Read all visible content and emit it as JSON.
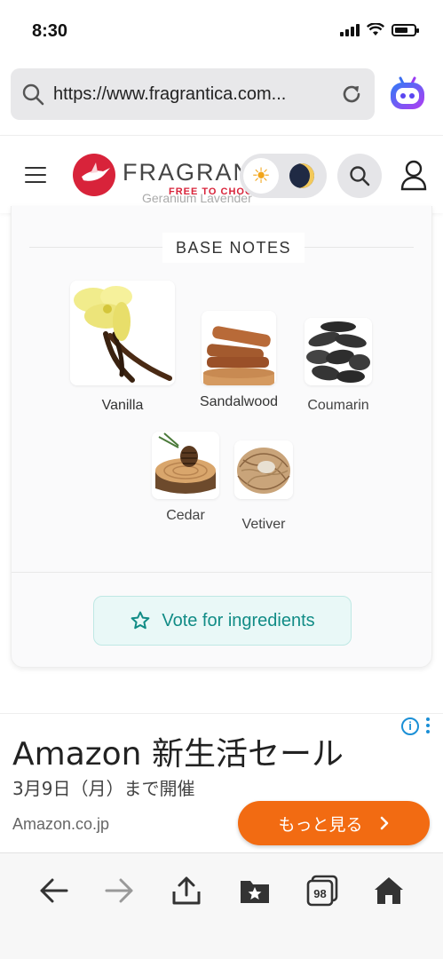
{
  "status_bar": {
    "time": "8:30"
  },
  "browser": {
    "url": "https://www.fragrantica.com...",
    "tabs_count": "98"
  },
  "site_header": {
    "logo_text": "FRAGRANTICA",
    "tagline": "FREE TO CHOOSE",
    "ghost_notes": "Geranium   Lavender"
  },
  "base_notes": {
    "title": "BASE NOTES",
    "items": [
      {
        "label": "Vanilla"
      },
      {
        "label": "Sandalwood"
      },
      {
        "label": "Coumarin"
      },
      {
        "label": "Cedar"
      },
      {
        "label": "Vetiver"
      }
    ]
  },
  "vote": {
    "label": "Vote for ingredients"
  },
  "ad": {
    "title": "Amazon 新生活セール",
    "subtitle": "3月9日（月）まで開催",
    "domain": "Amazon.co.jp",
    "cta": "もっと見る",
    "info": "i"
  },
  "colors": {
    "brand_red": "#d8233a",
    "teal": "#118c86",
    "ad_orange": "#f26b12"
  }
}
